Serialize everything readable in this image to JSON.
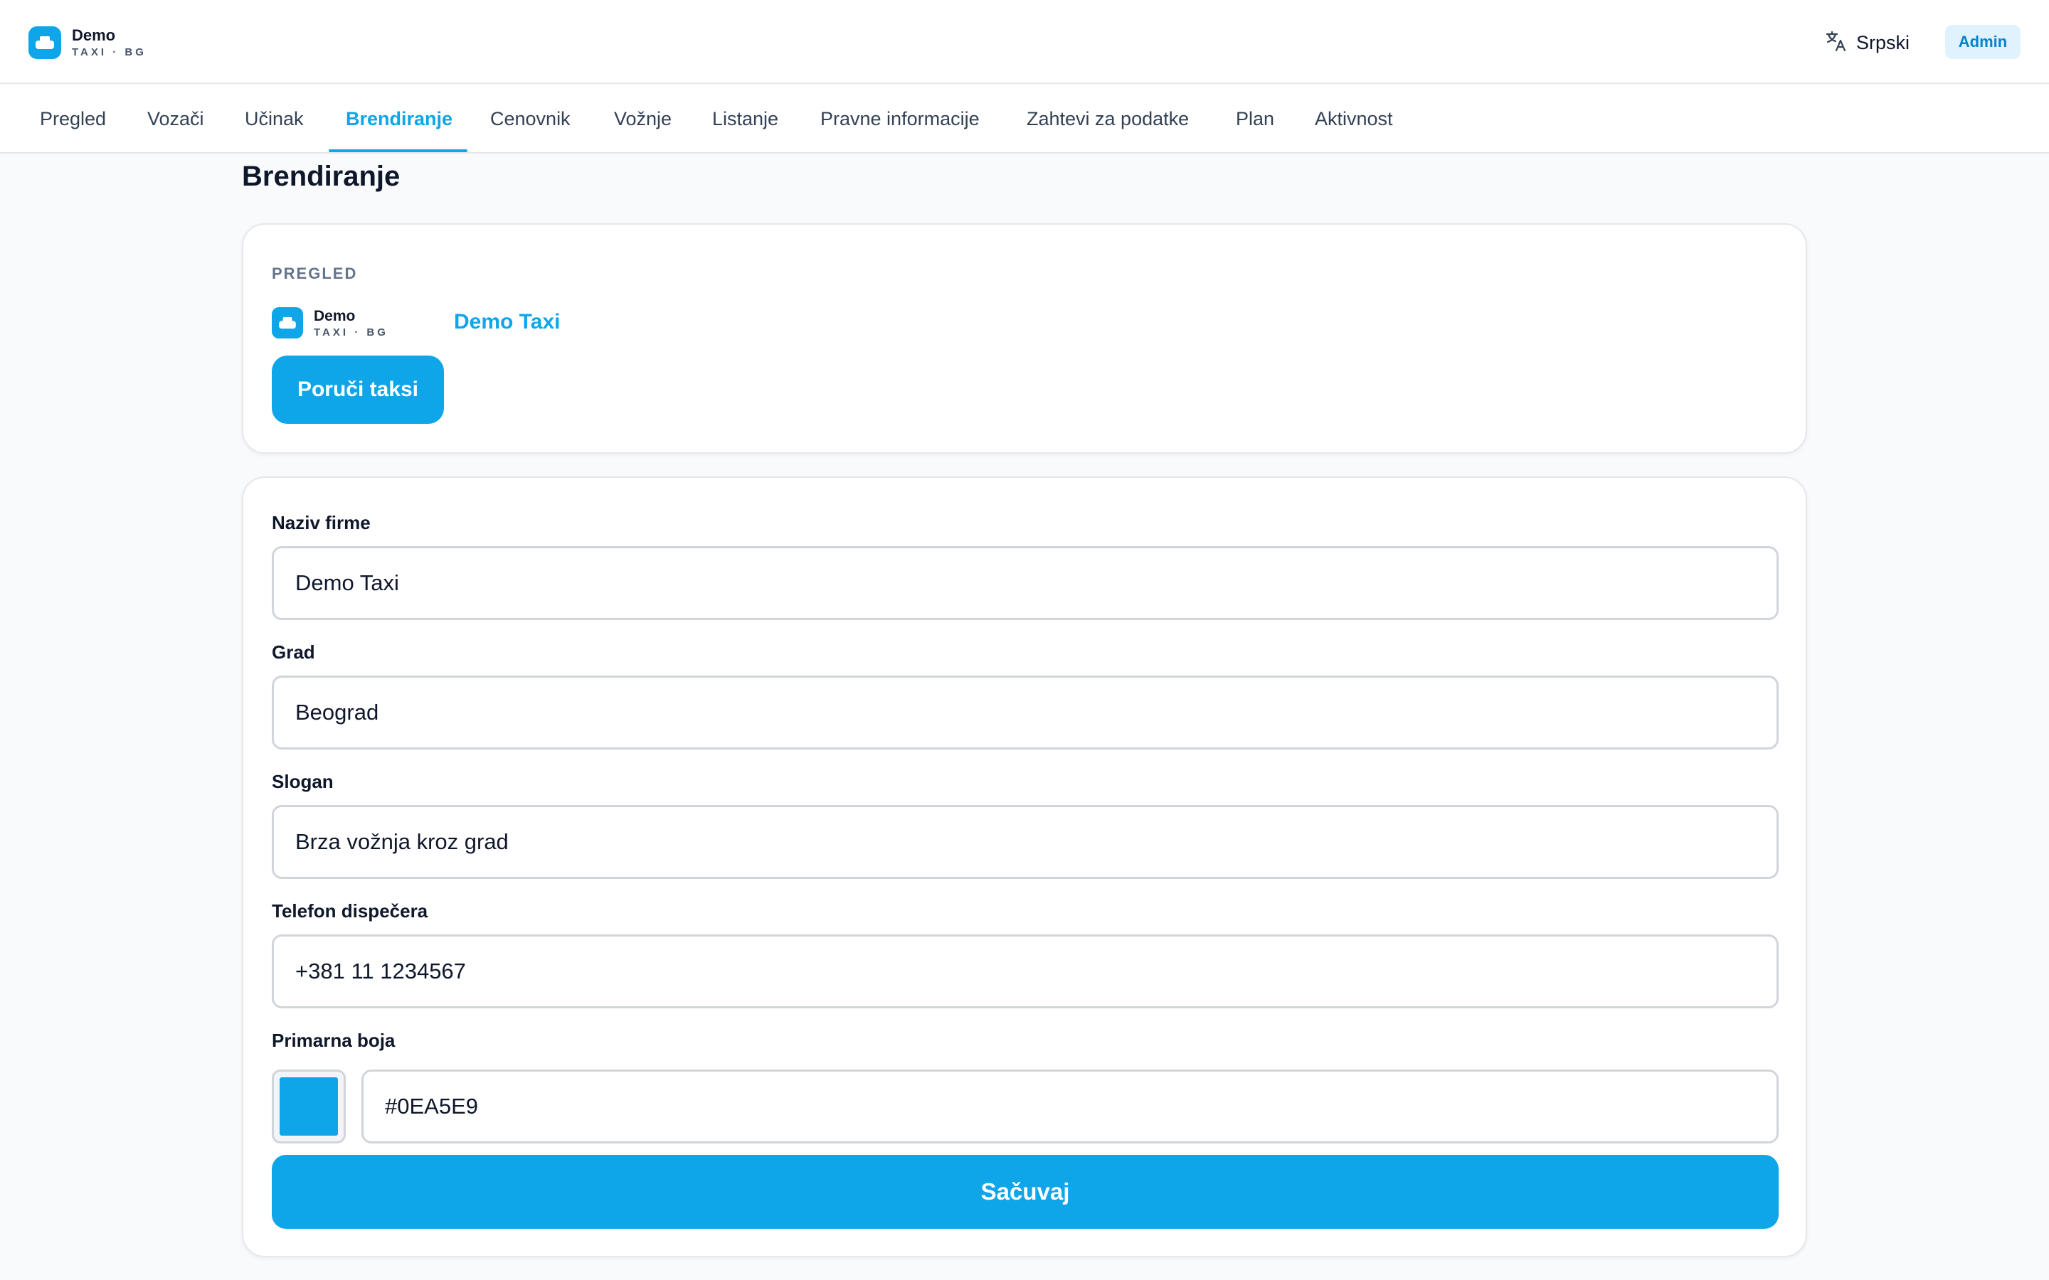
{
  "brand": {
    "name": "Demo",
    "sub": "TAXI · BG",
    "icon": "taxi-icon"
  },
  "header": {
    "language": "Srpski",
    "language_icon": "translate-icon",
    "role_badge": "Admin"
  },
  "tabs": [
    {
      "label": "Pregled",
      "active": false
    },
    {
      "label": "Vozači",
      "active": false
    },
    {
      "label": "Učinak",
      "active": false
    },
    {
      "label": "Brendiranje",
      "active": true
    },
    {
      "label": "Cenovnik",
      "active": false
    },
    {
      "label": "Vožnje",
      "active": false
    },
    {
      "label": "Listanje",
      "active": false
    },
    {
      "label": "Pravne informacije",
      "active": false
    },
    {
      "label": "Zahtevi za podatke",
      "active": false
    },
    {
      "label": "Plan",
      "active": false
    },
    {
      "label": "Aktivnost",
      "active": false
    }
  ],
  "page": {
    "title": "Brendiranje"
  },
  "preview": {
    "section_label": "PREGLED",
    "company_name": "Demo Taxi",
    "order_button": "Poruči taksi"
  },
  "form": {
    "company": {
      "label": "Naziv firme",
      "value": "Demo Taxi"
    },
    "city": {
      "label": "Grad",
      "value": "Beograd"
    },
    "slogan": {
      "label": "Slogan",
      "value": "Brza vožnja kroz grad"
    },
    "phone": {
      "label": "Telefon dispečera",
      "value": "+381 11 1234567"
    },
    "color": {
      "label": "Primarna boja",
      "value": "#0EA5E9"
    },
    "save_button": "Sačuvaj"
  },
  "colors": {
    "accent": "#0ea5e9",
    "accent_light": "#e0f2fe",
    "text": "#0f172a",
    "border": "#d1d5db"
  }
}
